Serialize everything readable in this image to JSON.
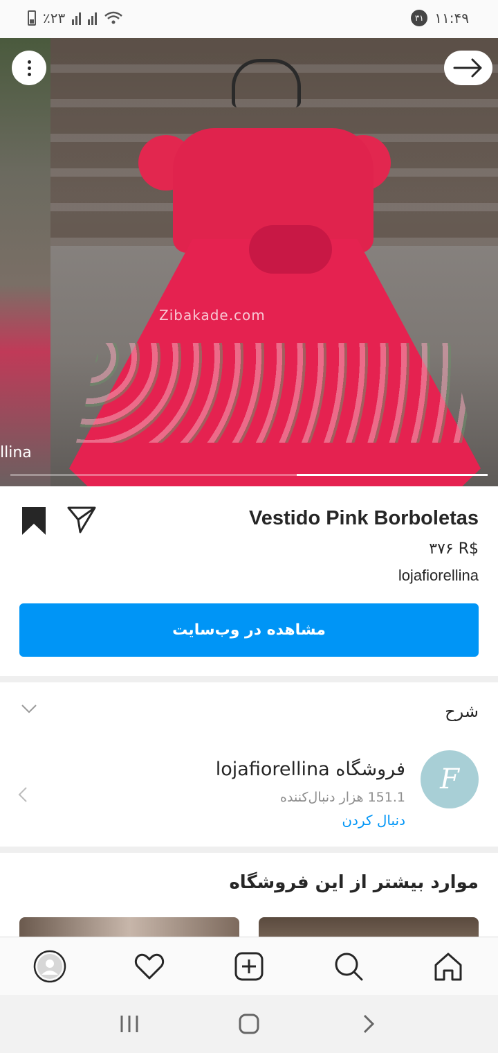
{
  "status_bar": {
    "battery_percent": "٪۲۳",
    "time": "۱۱:۴۹",
    "notification_count": "۳۱"
  },
  "hero": {
    "prev_slide_label": "llina",
    "watermark": "Zibakade.com",
    "slide_progress": 0.6
  },
  "product": {
    "title": "Vestido Pink Borboletas",
    "price": "۳۷۶ R$",
    "shop": "lojafiorellina",
    "cta_label": "مشاهده در وب‌سایت"
  },
  "description": {
    "title": "شرح",
    "store_name": "فروشگاه lojafiorellina",
    "followers": "151.1 هزار دنبال‌کننده",
    "follow_label": "دنبال کردن",
    "avatar_letter": "F"
  },
  "more_section": {
    "title": "موارد بیشتر از این فروشگاه"
  }
}
